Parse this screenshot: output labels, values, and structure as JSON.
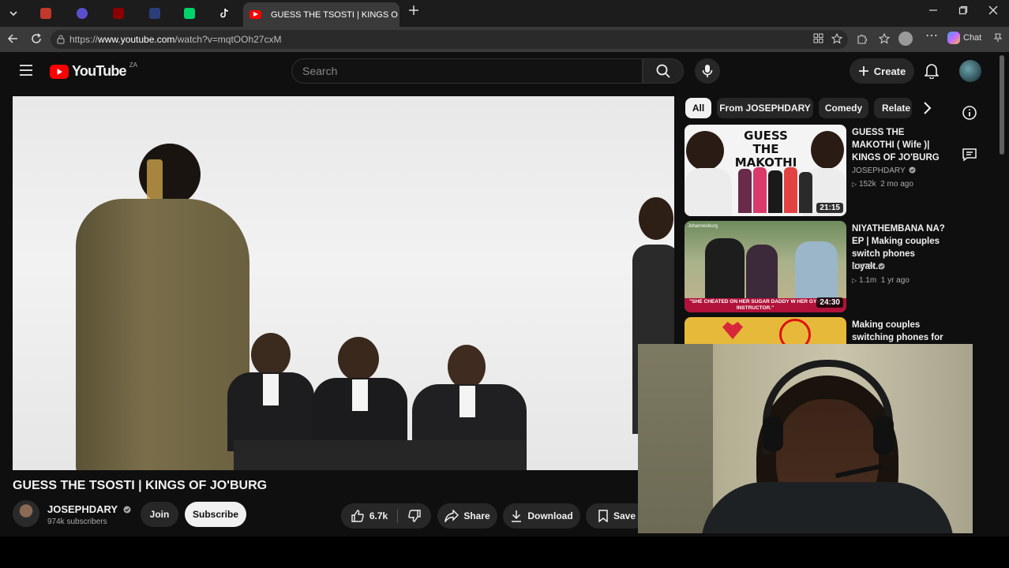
{
  "browser": {
    "tabs": [
      {
        "name": "tab-1",
        "color": "#c0392b",
        "letter": "U"
      },
      {
        "name": "tab-2",
        "color": "#5a4fcf",
        "letter": ""
      },
      {
        "name": "tab-3",
        "color": "#8b0000",
        "letter": ""
      },
      {
        "name": "tab-4",
        "color": "#2c3e7a",
        "letter": ""
      },
      {
        "name": "tab-5",
        "color": "#00d36b",
        "letter": "K"
      },
      {
        "name": "tab-6",
        "color": "#111111",
        "letter": "♪"
      }
    ],
    "active_tab_title": "GUESS THE TSOSTI | KINGS O",
    "url_prefix": "https://",
    "url_host": "www.youtube.com",
    "url_path": "/watch?v=mqtOOh27cxM",
    "chat_label": "Chat"
  },
  "youtube": {
    "logo_text": "YouTube",
    "region": "ZA",
    "search_placeholder": "Search",
    "create_label": "Create"
  },
  "video": {
    "title": "GUESS THE TSOSTI | KINGS OF JO'BURG",
    "channel": "JOSEPHDARY",
    "subscribers": "974k subscribers",
    "join_label": "Join",
    "subscribe_label": "Subscribe",
    "likes": "6.7k",
    "share_label": "Share",
    "download_label": "Download",
    "save_label": "Save"
  },
  "chips": [
    "All",
    "From JOSEPHDARY",
    "Comedy",
    "Relate"
  ],
  "recommendations": [
    {
      "title": "GUESS THE MAKOTHI ( Wife )| KINGS OF JO'BURG",
      "channel": "JOSEPHDARY",
      "views": "152k",
      "age": "2 mo ago",
      "duration": "21:15",
      "thumb_text": "GUESS THE MAKOTHI"
    },
    {
      "title": "NIYATHEMBANA NA? EP | Making couples switch phones loyalt...",
      "channel": "CMTV",
      "views": "1.1m",
      "age": "1 yr ago",
      "duration": "24:30",
      "thumb_text": "\"SHE CHEATED ON HER SUGAR DADDY W HER GYM INSTRUCTOR.\"",
      "thumb_tag": "Johannesburg"
    },
    {
      "title": "Making couples switching phones for",
      "channel": "",
      "views": "",
      "age": "",
      "duration": ""
    }
  ]
}
